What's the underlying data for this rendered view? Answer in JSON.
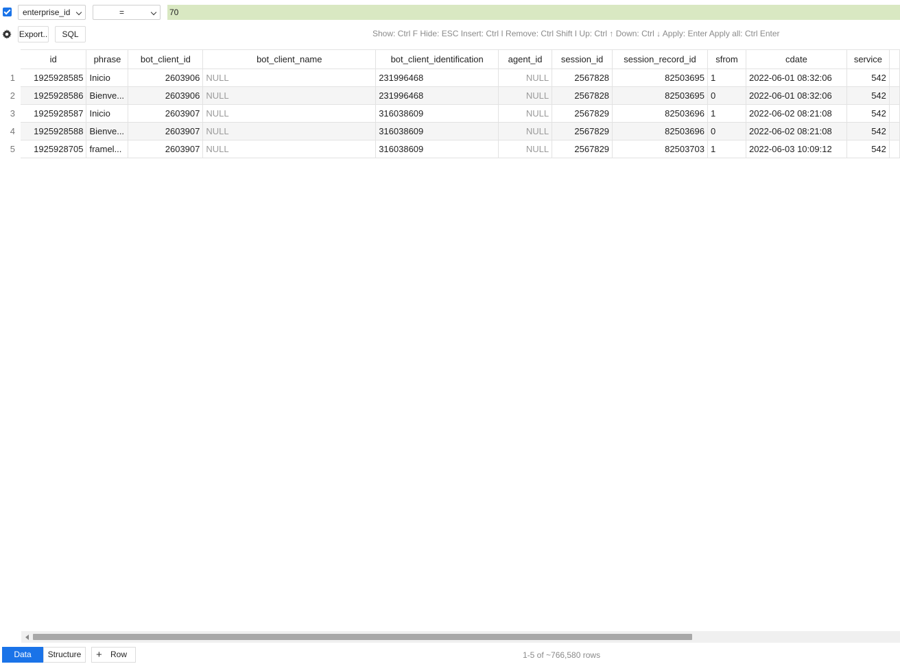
{
  "filter": {
    "enabled": true,
    "column": "enterprise_id",
    "operator": "=",
    "value": "70"
  },
  "toolbar": {
    "export_label": "Export..",
    "sql_label": "SQL",
    "hints": "Show: Ctrl F Hide: ESC Insert: Ctrl I Remove: Ctrl Shift I Up: Ctrl ↑ Down: Ctrl ↓ Apply: Enter Apply all: Ctrl Enter"
  },
  "table": {
    "columns": [
      "id",
      "phrase",
      "bot_client_id",
      "bot_client_name",
      "bot_client_identification",
      "agent_id",
      "session_id",
      "session_record_id",
      "sfrom",
      "cdate",
      "service",
      ""
    ],
    "rows": [
      {
        "n": "1",
        "cells": [
          "1925928585",
          "Inicio",
          "2603906",
          "NULL",
          "231996468",
          "NULL",
          "2567828",
          "82503695",
          "1",
          "2022-06-01 08:32:06",
          "542"
        ]
      },
      {
        "n": "2",
        "cells": [
          "1925928586",
          "Bienve...",
          "2603906",
          "NULL",
          "231996468",
          "NULL",
          "2567828",
          "82503695",
          "0",
          "2022-06-01 08:32:06",
          "542"
        ]
      },
      {
        "n": "3",
        "cells": [
          "1925928587",
          "Inicio",
          "2603907",
          "NULL",
          "316038609",
          "NULL",
          "2567829",
          "82503696",
          "1",
          "2022-06-02 08:21:08",
          "542"
        ]
      },
      {
        "n": "4",
        "cells": [
          "1925928588",
          "Bienve...",
          "2603907",
          "NULL",
          "316038609",
          "NULL",
          "2567829",
          "82503696",
          "0",
          "2022-06-02 08:21:08",
          "542"
        ]
      },
      {
        "n": "5",
        "cells": [
          "1925928705",
          "framel...",
          "2603907",
          "NULL",
          "316038609",
          "NULL",
          "2567829",
          "82503703",
          "1",
          "2022-06-03 10:09:12",
          "542"
        ]
      }
    ]
  },
  "footer": {
    "tab_data": "Data",
    "tab_structure": "Structure",
    "tab_row": "Row",
    "status": "1-5 of ~766,580 rows"
  }
}
